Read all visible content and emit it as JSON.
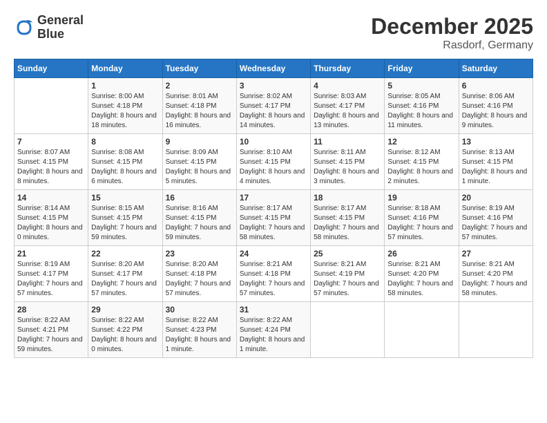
{
  "header": {
    "logo": {
      "line1": "General",
      "line2": "Blue"
    },
    "title": "December 2025",
    "location": "Rasdorf, Germany"
  },
  "weekdays": [
    "Sunday",
    "Monday",
    "Tuesday",
    "Wednesday",
    "Thursday",
    "Friday",
    "Saturday"
  ],
  "weeks": [
    [
      {
        "day": null,
        "info": ""
      },
      {
        "day": "1",
        "sunrise": "Sunrise: 8:00 AM",
        "sunset": "Sunset: 4:18 PM",
        "daylight": "Daylight: 8 hours and 18 minutes."
      },
      {
        "day": "2",
        "sunrise": "Sunrise: 8:01 AM",
        "sunset": "Sunset: 4:18 PM",
        "daylight": "Daylight: 8 hours and 16 minutes."
      },
      {
        "day": "3",
        "sunrise": "Sunrise: 8:02 AM",
        "sunset": "Sunset: 4:17 PM",
        "daylight": "Daylight: 8 hours and 14 minutes."
      },
      {
        "day": "4",
        "sunrise": "Sunrise: 8:03 AM",
        "sunset": "Sunset: 4:17 PM",
        "daylight": "Daylight: 8 hours and 13 minutes."
      },
      {
        "day": "5",
        "sunrise": "Sunrise: 8:05 AM",
        "sunset": "Sunset: 4:16 PM",
        "daylight": "Daylight: 8 hours and 11 minutes."
      },
      {
        "day": "6",
        "sunrise": "Sunrise: 8:06 AM",
        "sunset": "Sunset: 4:16 PM",
        "daylight": "Daylight: 8 hours and 9 minutes."
      }
    ],
    [
      {
        "day": "7",
        "sunrise": "Sunrise: 8:07 AM",
        "sunset": "Sunset: 4:15 PM",
        "daylight": "Daylight: 8 hours and 8 minutes."
      },
      {
        "day": "8",
        "sunrise": "Sunrise: 8:08 AM",
        "sunset": "Sunset: 4:15 PM",
        "daylight": "Daylight: 8 hours and 6 minutes."
      },
      {
        "day": "9",
        "sunrise": "Sunrise: 8:09 AM",
        "sunset": "Sunset: 4:15 PM",
        "daylight": "Daylight: 8 hours and 5 minutes."
      },
      {
        "day": "10",
        "sunrise": "Sunrise: 8:10 AM",
        "sunset": "Sunset: 4:15 PM",
        "daylight": "Daylight: 8 hours and 4 minutes."
      },
      {
        "day": "11",
        "sunrise": "Sunrise: 8:11 AM",
        "sunset": "Sunset: 4:15 PM",
        "daylight": "Daylight: 8 hours and 3 minutes."
      },
      {
        "day": "12",
        "sunrise": "Sunrise: 8:12 AM",
        "sunset": "Sunset: 4:15 PM",
        "daylight": "Daylight: 8 hours and 2 minutes."
      },
      {
        "day": "13",
        "sunrise": "Sunrise: 8:13 AM",
        "sunset": "Sunset: 4:15 PM",
        "daylight": "Daylight: 8 hours and 1 minute."
      }
    ],
    [
      {
        "day": "14",
        "sunrise": "Sunrise: 8:14 AM",
        "sunset": "Sunset: 4:15 PM",
        "daylight": "Daylight: 8 hours and 0 minutes."
      },
      {
        "day": "15",
        "sunrise": "Sunrise: 8:15 AM",
        "sunset": "Sunset: 4:15 PM",
        "daylight": "Daylight: 7 hours and 59 minutes."
      },
      {
        "day": "16",
        "sunrise": "Sunrise: 8:16 AM",
        "sunset": "Sunset: 4:15 PM",
        "daylight": "Daylight: 7 hours and 59 minutes."
      },
      {
        "day": "17",
        "sunrise": "Sunrise: 8:17 AM",
        "sunset": "Sunset: 4:15 PM",
        "daylight": "Daylight: 7 hours and 58 minutes."
      },
      {
        "day": "18",
        "sunrise": "Sunrise: 8:17 AM",
        "sunset": "Sunset: 4:15 PM",
        "daylight": "Daylight: 7 hours and 58 minutes."
      },
      {
        "day": "19",
        "sunrise": "Sunrise: 8:18 AM",
        "sunset": "Sunset: 4:16 PM",
        "daylight": "Daylight: 7 hours and 57 minutes."
      },
      {
        "day": "20",
        "sunrise": "Sunrise: 8:19 AM",
        "sunset": "Sunset: 4:16 PM",
        "daylight": "Daylight: 7 hours and 57 minutes."
      }
    ],
    [
      {
        "day": "21",
        "sunrise": "Sunrise: 8:19 AM",
        "sunset": "Sunset: 4:17 PM",
        "daylight": "Daylight: 7 hours and 57 minutes."
      },
      {
        "day": "22",
        "sunrise": "Sunrise: 8:20 AM",
        "sunset": "Sunset: 4:17 PM",
        "daylight": "Daylight: 7 hours and 57 minutes."
      },
      {
        "day": "23",
        "sunrise": "Sunrise: 8:20 AM",
        "sunset": "Sunset: 4:18 PM",
        "daylight": "Daylight: 7 hours and 57 minutes."
      },
      {
        "day": "24",
        "sunrise": "Sunrise: 8:21 AM",
        "sunset": "Sunset: 4:18 PM",
        "daylight": "Daylight: 7 hours and 57 minutes."
      },
      {
        "day": "25",
        "sunrise": "Sunrise: 8:21 AM",
        "sunset": "Sunset: 4:19 PM",
        "daylight": "Daylight: 7 hours and 57 minutes."
      },
      {
        "day": "26",
        "sunrise": "Sunrise: 8:21 AM",
        "sunset": "Sunset: 4:20 PM",
        "daylight": "Daylight: 7 hours and 58 minutes."
      },
      {
        "day": "27",
        "sunrise": "Sunrise: 8:21 AM",
        "sunset": "Sunset: 4:20 PM",
        "daylight": "Daylight: 7 hours and 58 minutes."
      }
    ],
    [
      {
        "day": "28",
        "sunrise": "Sunrise: 8:22 AM",
        "sunset": "Sunset: 4:21 PM",
        "daylight": "Daylight: 7 hours and 59 minutes."
      },
      {
        "day": "29",
        "sunrise": "Sunrise: 8:22 AM",
        "sunset": "Sunset: 4:22 PM",
        "daylight": "Daylight: 8 hours and 0 minutes."
      },
      {
        "day": "30",
        "sunrise": "Sunrise: 8:22 AM",
        "sunset": "Sunset: 4:23 PM",
        "daylight": "Daylight: 8 hours and 1 minute."
      },
      {
        "day": "31",
        "sunrise": "Sunrise: 8:22 AM",
        "sunset": "Sunset: 4:24 PM",
        "daylight": "Daylight: 8 hours and 1 minute."
      },
      {
        "day": null,
        "info": ""
      },
      {
        "day": null,
        "info": ""
      },
      {
        "day": null,
        "info": ""
      }
    ]
  ]
}
